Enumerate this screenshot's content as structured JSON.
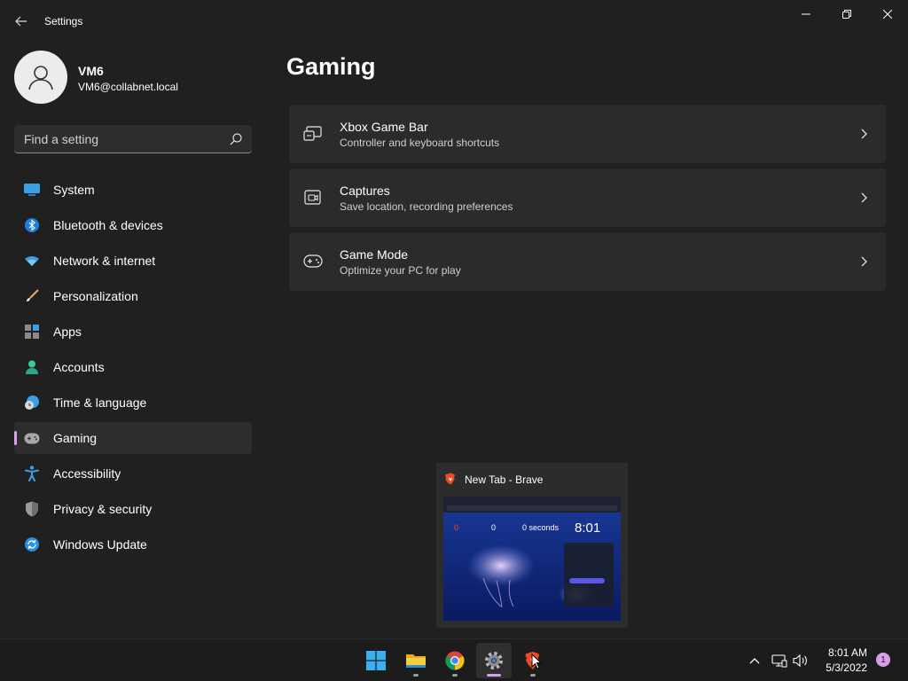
{
  "window": {
    "title": "Settings"
  },
  "profile": {
    "name": "VM6",
    "email": "VM6@collabnet.local"
  },
  "search": {
    "placeholder": "Find a setting",
    "value": ""
  },
  "nav": [
    {
      "label": "System",
      "icon": "system-icon",
      "selected": false
    },
    {
      "label": "Bluetooth & devices",
      "icon": "bluetooth-icon",
      "selected": false
    },
    {
      "label": "Network & internet",
      "icon": "wifi-icon",
      "selected": false
    },
    {
      "label": "Personalization",
      "icon": "brush-icon",
      "selected": false
    },
    {
      "label": "Apps",
      "icon": "apps-icon",
      "selected": false
    },
    {
      "label": "Accounts",
      "icon": "accounts-icon",
      "selected": false
    },
    {
      "label": "Time & language",
      "icon": "time-language-icon",
      "selected": false
    },
    {
      "label": "Gaming",
      "icon": "gamepad-icon",
      "selected": true
    },
    {
      "label": "Accessibility",
      "icon": "accessibility-icon",
      "selected": false
    },
    {
      "label": "Privacy & security",
      "icon": "shield-icon",
      "selected": false
    },
    {
      "label": "Windows Update",
      "icon": "update-icon",
      "selected": false
    }
  ],
  "main": {
    "title": "Gaming",
    "cards": [
      {
        "title": "Xbox Game Bar",
        "subtitle": "Controller and keyboard shortcuts",
        "icon": "game-bar-icon"
      },
      {
        "title": "Captures",
        "subtitle": "Save location, recording preferences",
        "icon": "captures-icon"
      },
      {
        "title": "Game Mode",
        "subtitle": "Optimize your PC for play",
        "icon": "gamepad-icon"
      }
    ]
  },
  "preview": {
    "title": "New Tab - Brave",
    "icon": "brave-icon",
    "thumb_clock": "8:01",
    "thumb_stats": [
      "0",
      "0",
      "0 seconds"
    ]
  },
  "taskbar": {
    "apps": [
      {
        "name": "start",
        "icon": "windows-start-icon",
        "active": false,
        "running": false
      },
      {
        "name": "file-explorer",
        "icon": "folder-icon",
        "active": false,
        "running": true
      },
      {
        "name": "chrome",
        "icon": "chrome-icon",
        "active": false,
        "running": true
      },
      {
        "name": "settings",
        "icon": "gear-icon",
        "active": true,
        "running": true
      },
      {
        "name": "brave",
        "icon": "brave-icon",
        "active": false,
        "running": true
      }
    ],
    "time": "8:01 AM",
    "date": "5/3/2022",
    "notifications": "1"
  },
  "colors": {
    "background": "#202020",
    "card": "#2b2b2b",
    "accent": "#d8a0e8",
    "taskbar": "#1c1c1c"
  }
}
